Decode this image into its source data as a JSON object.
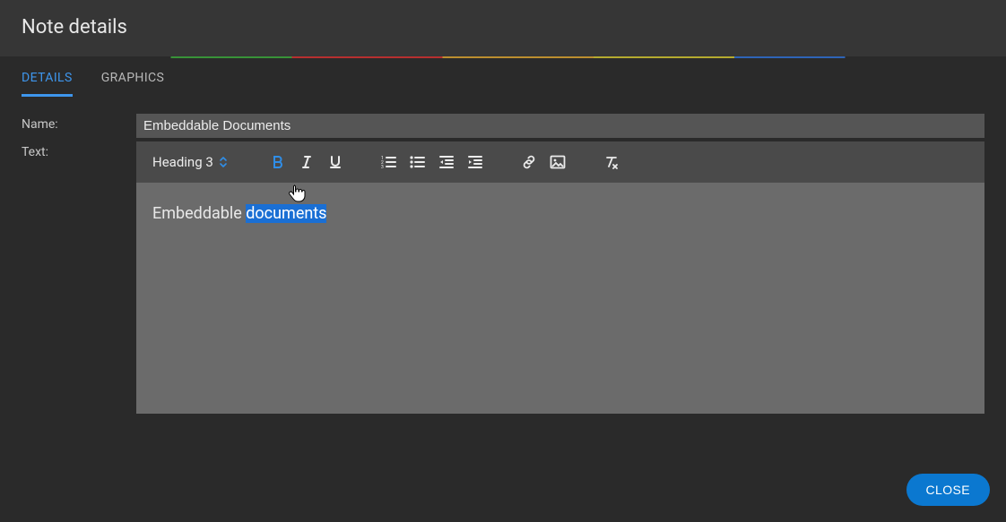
{
  "header": {
    "title": "Note details"
  },
  "tabs": [
    {
      "label": "DETAILS",
      "active": true
    },
    {
      "label": "GRAPHICS",
      "active": false
    }
  ],
  "form": {
    "name_label": "Name:",
    "text_label": "Text:",
    "name_value": "Embeddable Documents"
  },
  "toolbar": {
    "heading": "Heading 3",
    "bold_active": true,
    "icons": {
      "bold": "bold-icon",
      "italic": "italic-icon",
      "underline": "underline-icon",
      "olist": "ordered-list-icon",
      "ulist": "unordered-list-icon",
      "outdent": "outdent-icon",
      "indent": "indent-icon",
      "link": "link-icon",
      "image": "image-icon",
      "clearfmt": "clear-format-icon"
    }
  },
  "editor": {
    "text_before": "Embeddable ",
    "text_selected": "documents"
  },
  "footer": {
    "close_label": "CLOSE"
  }
}
